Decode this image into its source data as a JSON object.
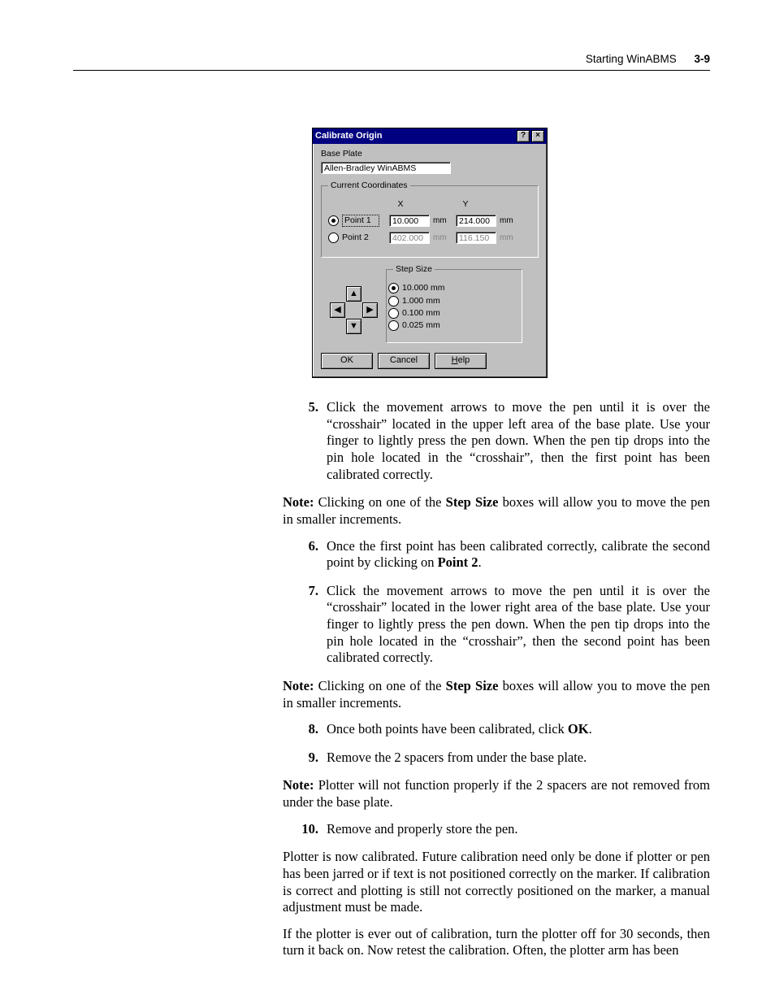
{
  "header": {
    "section": "Starting WinABMS",
    "page": "3-9"
  },
  "dialog": {
    "title": "Calibrate Origin",
    "base_plate_label": "Base Plate",
    "base_plate_value": "Allen-Bradley WinABMS",
    "coords": {
      "legend": "Current Coordinates",
      "x_head": "X",
      "y_head": "Y",
      "unit": "mm",
      "points": [
        {
          "label": "Point 1",
          "selected": true,
          "x": "10.000",
          "y": "214.000",
          "enabled": true
        },
        {
          "label": "Point 2",
          "selected": false,
          "x": "402.000",
          "y": "116.150",
          "enabled": false
        }
      ]
    },
    "step_size": {
      "legend": "Step Size",
      "options": [
        {
          "label": "10.000 mm",
          "selected": true
        },
        {
          "label": "1.000 mm",
          "selected": false
        },
        {
          "label": "0.100 mm",
          "selected": false
        },
        {
          "label": "0.025 mm",
          "selected": false
        }
      ]
    },
    "buttons": {
      "ok": "OK",
      "cancel": "Cancel",
      "help": "Help"
    }
  },
  "steps": {
    "s5": "Click the movement arrows to move the pen until it is over the “crosshair” located in the upper left area of the base plate. Use your finger to lightly press the pen down. When the pen tip drops into the pin hole located in the “crosshair”, then the first point has been calibrated correctly.",
    "s6a": "Once the first point has been calibrated correctly, calibrate the second point by clicking on ",
    "s6b": "Point 2",
    "s6c": ".",
    "s7": "Click the movement arrows to move the pen until it is over the “crosshair” located in the lower right area of the base plate. Use your finger to lightly press the pen down. When the pen tip drops into the pin hole located in the “crosshair”, then the second point has been calibrated correctly.",
    "s8a": "Once both points have been calibrated, click ",
    "s8b": "OK",
    "s8c": ".",
    "s9": "Remove the 2 spacers from under the base plate.",
    "s10": "Remove and properly store the pen."
  },
  "notes": {
    "label": "Note:",
    "n1a": " Clicking on one of the ",
    "n1b": "Step Size",
    "n1c": " boxes will allow you to move the pen in smaller increments.",
    "n2": " Plotter will not function properly if the 2 spacers are not removed from under the base plate."
  },
  "paras": {
    "p1": "Plotter is now calibrated. Future calibration need only be done if plotter or pen has been jarred or if text is not positioned correctly on the marker. If calibration is correct and plotting is still not correctly positioned on the marker, a manual adjustment must be made.",
    "p2": "If the plotter is ever out of calibration, turn the plotter off for 30 seconds, then turn it back on. Now retest the calibration. Often, the plotter arm has been"
  }
}
